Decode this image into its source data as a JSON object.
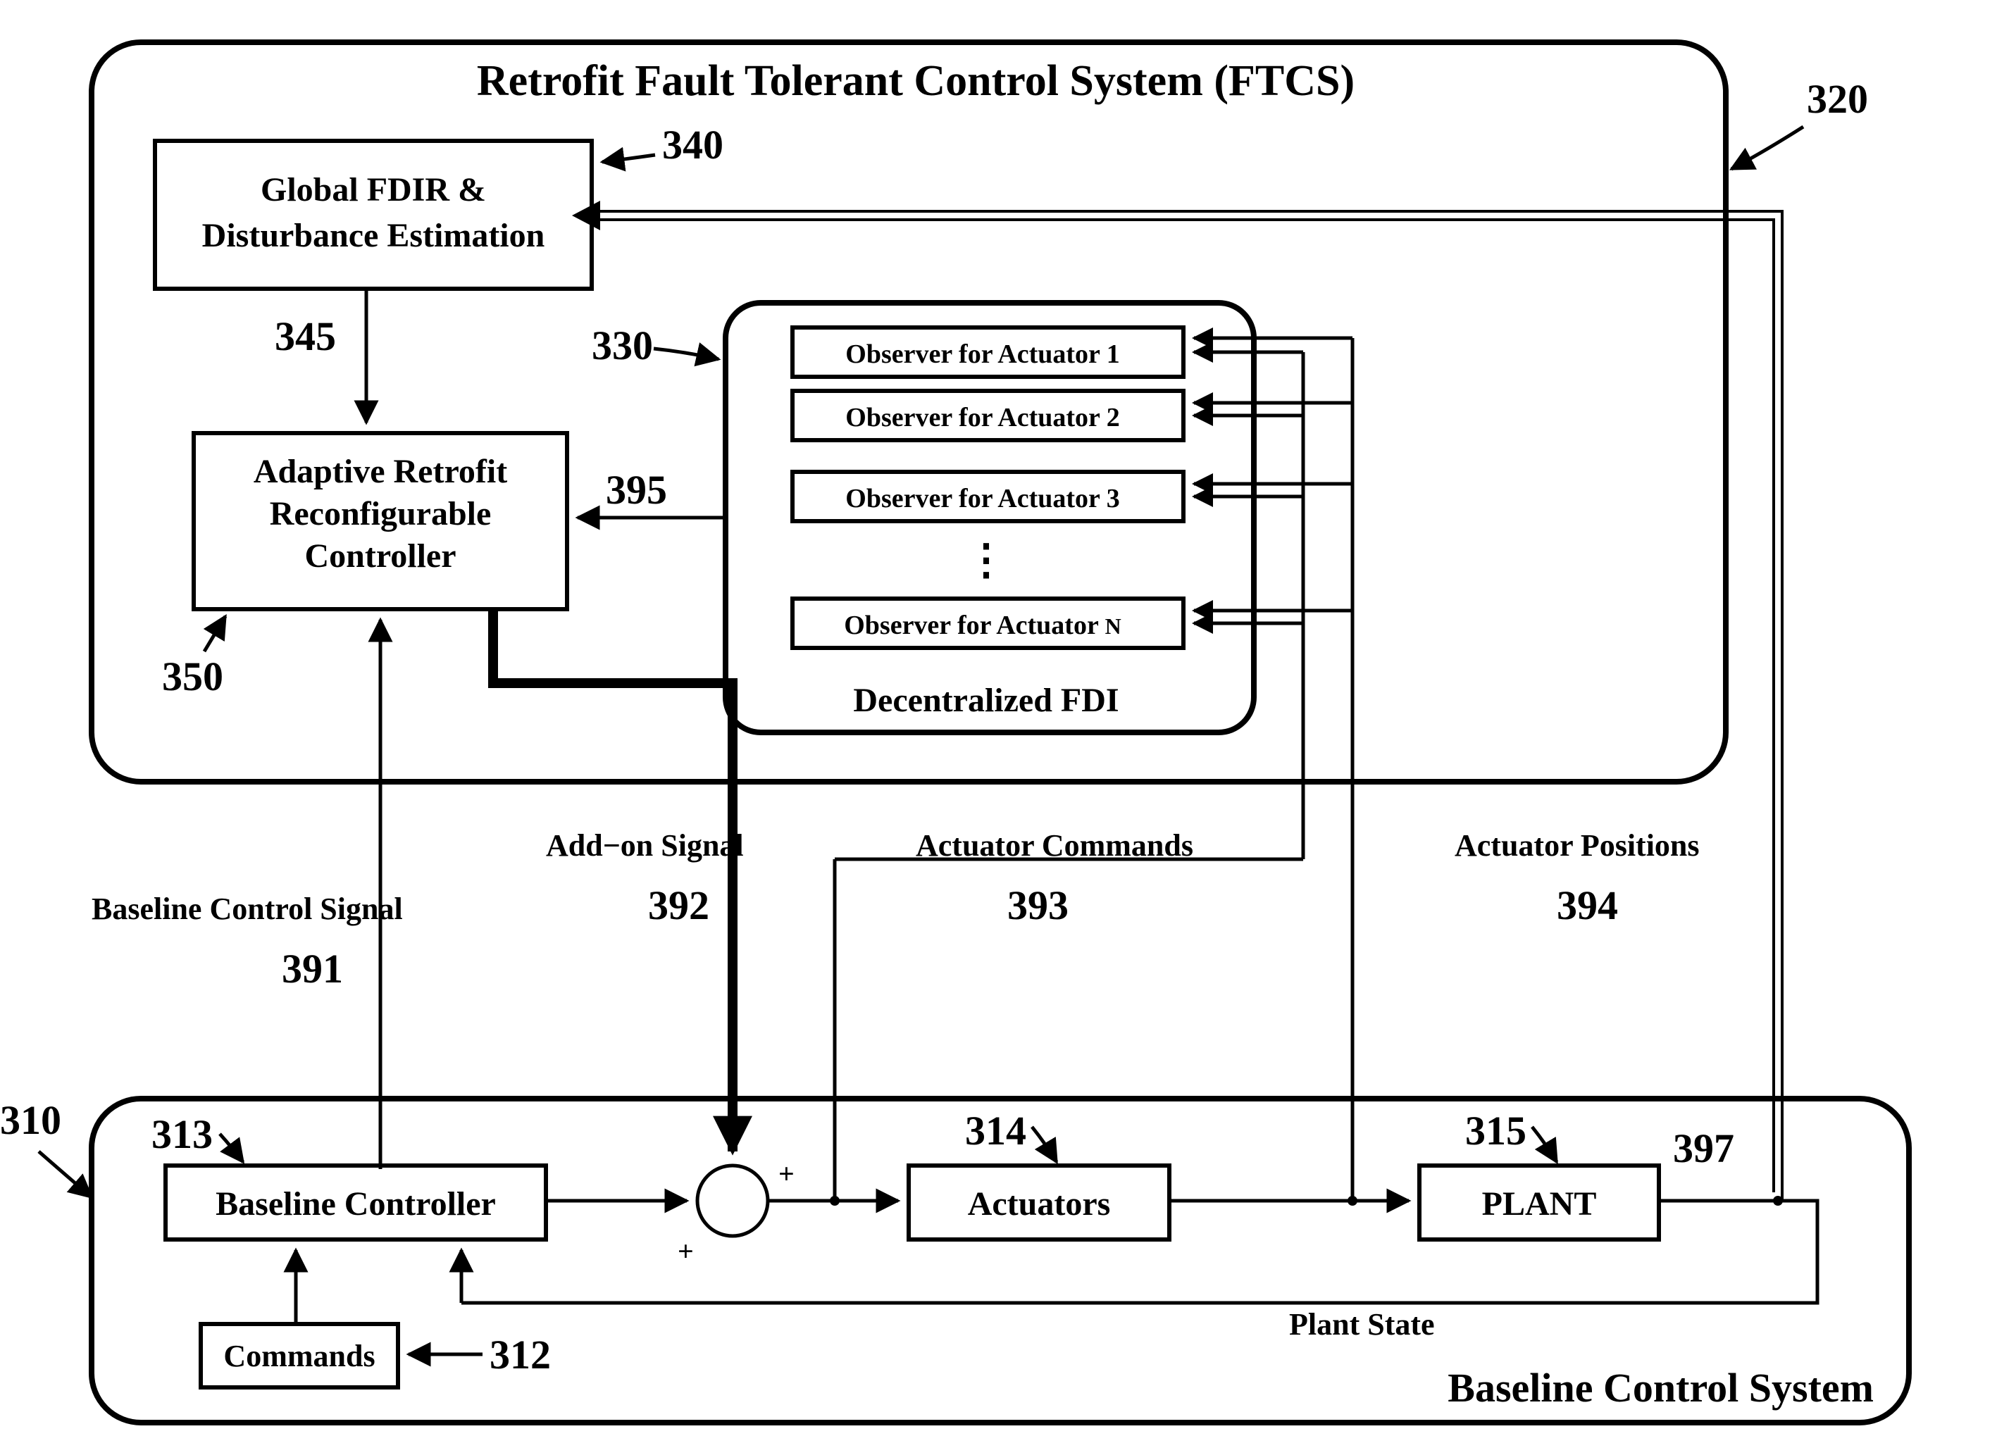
{
  "titles": {
    "ftcs": "Retrofit Fault Tolerant Control System (FTCS)",
    "baseline": "Baseline Control System",
    "fdi": "Decentralized FDI"
  },
  "blocks": {
    "global_fdir_l1": "Global FDIR &",
    "global_fdir_l2": "Disturbance Estimation",
    "adaptive_l1": "Adaptive Retrofit",
    "adaptive_l2": "Reconfigurable",
    "adaptive_l3": "Controller",
    "obs1": "Observer for Actuator 1",
    "obs2": "Observer for Actuator 2",
    "obs3": "Observer for Actuator 3",
    "obsN_pre": "Observer for Actuator ",
    "obsN_n": "N",
    "baseline_ctrl": "Baseline Controller",
    "commands": "Commands",
    "actuators": "Actuators",
    "plant": "PLANT"
  },
  "signals": {
    "addon": "Add−on Signal",
    "act_cmds": "Actuator Commands",
    "act_pos": "Actuator Positions",
    "baseline_sig": "Baseline Control Signal",
    "plant_state": "Plant State"
  },
  "refs": {
    "r310": "310",
    "r312": "312",
    "r313": "313",
    "r314": "314",
    "r315": "315",
    "r320": "320",
    "r330": "330",
    "r340": "340",
    "r345": "345",
    "r350": "350",
    "r391": "391",
    "r392": "392",
    "r393": "393",
    "r394": "394",
    "r395": "395",
    "r397": "397"
  },
  "sym": {
    "plus": "+",
    "dots": "⋮"
  }
}
